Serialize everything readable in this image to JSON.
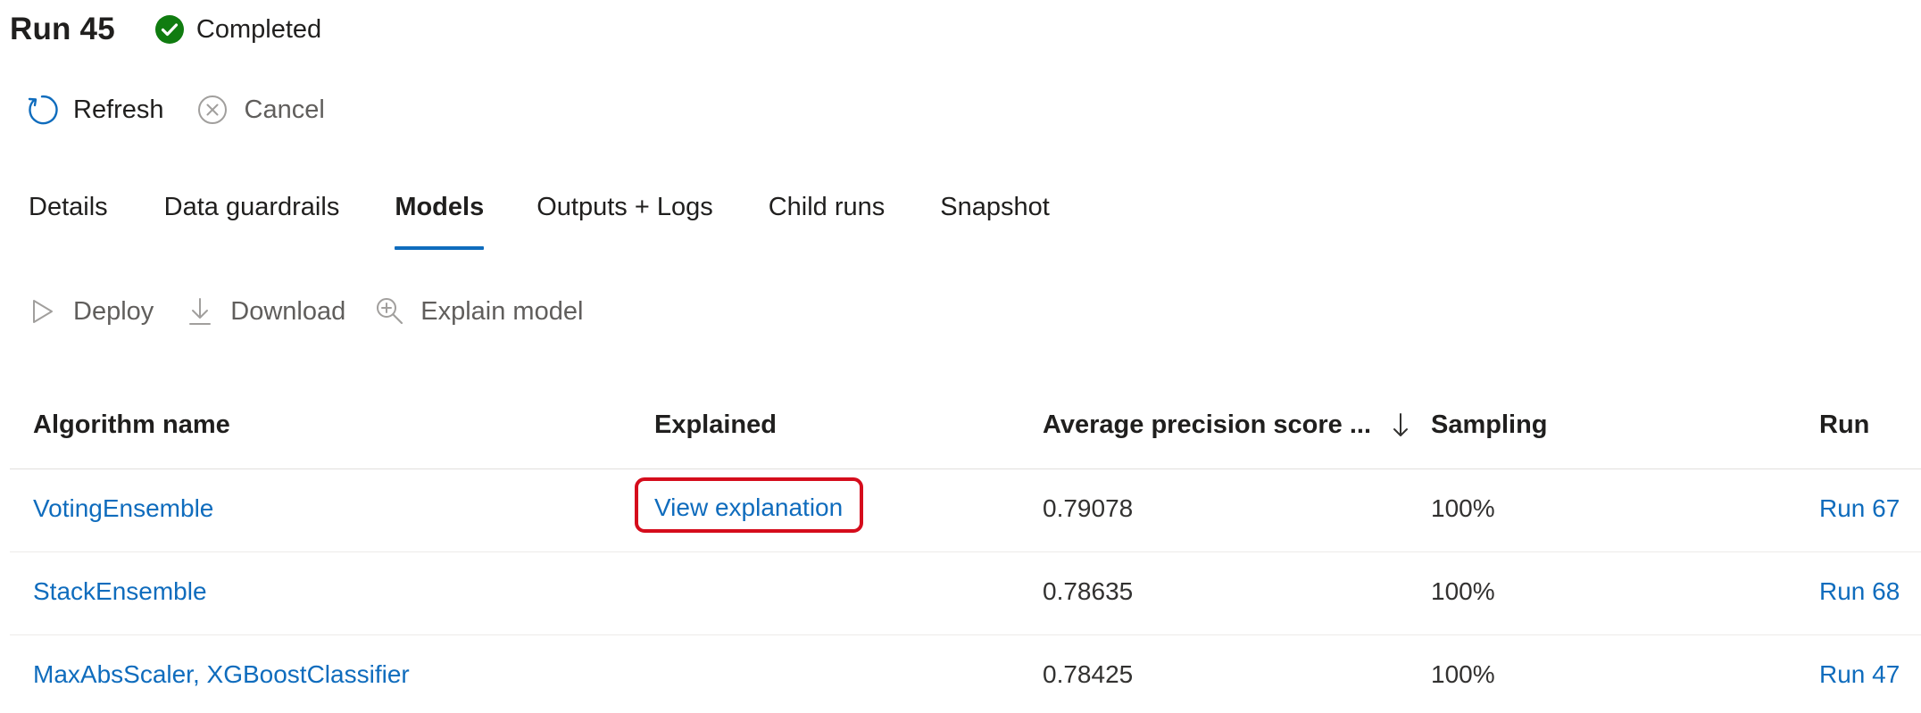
{
  "header": {
    "title": "Run 45",
    "status": {
      "label": "Completed",
      "icon": "check-circle-icon",
      "color": "#107c10"
    }
  },
  "commands": {
    "refresh": {
      "label": "Refresh",
      "icon": "refresh-icon"
    },
    "cancel": {
      "label": "Cancel",
      "icon": "cancel-circle-icon"
    }
  },
  "tabs": [
    {
      "label": "Details",
      "active": false
    },
    {
      "label": "Data guardrails",
      "active": false
    },
    {
      "label": "Models",
      "active": true
    },
    {
      "label": "Outputs + Logs",
      "active": false
    },
    {
      "label": "Child runs",
      "active": false
    },
    {
      "label": "Snapshot",
      "active": false
    }
  ],
  "actions": {
    "deploy": {
      "label": "Deploy",
      "icon": "play-icon"
    },
    "download": {
      "label": "Download",
      "icon": "download-icon"
    },
    "explain": {
      "label": "Explain model",
      "icon": "zoom-in-icon"
    }
  },
  "table": {
    "columns": {
      "algorithm": "Algorithm name",
      "explained": "Explained",
      "score": "Average precision score ...",
      "sampling": "Sampling",
      "run": "Run"
    },
    "sort_icon": "arrow-down-icon",
    "rows": [
      {
        "algorithm": "VotingEnsemble",
        "explained": "View explanation",
        "score": "0.79078",
        "sampling": "100%",
        "run": "Run 67"
      },
      {
        "algorithm": "StackEnsemble",
        "explained": "",
        "score": "0.78635",
        "sampling": "100%",
        "run": "Run 68"
      },
      {
        "algorithm": "MaxAbsScaler, XGBoostClassifier",
        "explained": "",
        "score": "0.78425",
        "sampling": "100%",
        "run": "Run 47"
      }
    ]
  },
  "colors": {
    "accent": "#0f6cbd",
    "link": "#0f6cbd",
    "highlight": "#d50c1c",
    "success": "#107c10"
  }
}
